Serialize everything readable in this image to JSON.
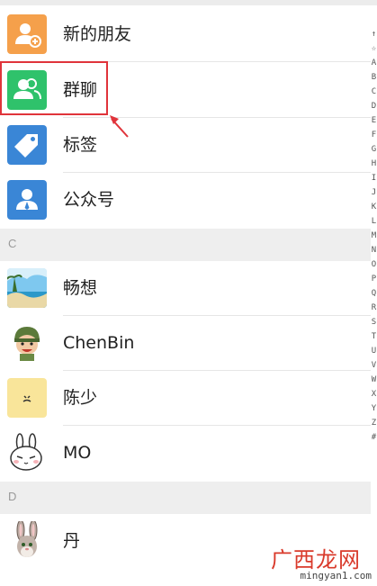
{
  "functions": [
    {
      "label": "新的朋友",
      "icon": "new-friend-icon",
      "color": "#f5a04b"
    },
    {
      "label": "群聊",
      "icon": "group-chat-icon",
      "color": "#2fc26b"
    },
    {
      "label": "标签",
      "icon": "tag-icon",
      "color": "#3a86d6"
    },
    {
      "label": "公众号",
      "icon": "official-account-icon",
      "color": "#3a86d6"
    }
  ],
  "sections": [
    {
      "letter": "C",
      "contacts": [
        "畅想",
        "ChenBin",
        "陈少",
        "MO"
      ]
    },
    {
      "letter": "D",
      "contacts": [
        "丹"
      ]
    }
  ],
  "annotation": {
    "highlight_color": "#e0343b"
  },
  "index_bar": [
    "↑",
    "☆",
    "A",
    "B",
    "C",
    "D",
    "E",
    "F",
    "G",
    "H",
    "I",
    "J",
    "K",
    "L",
    "M",
    "N",
    "O",
    "P",
    "Q",
    "R",
    "S",
    "T",
    "U",
    "V",
    "W",
    "X",
    "Y",
    "Z",
    "#"
  ],
  "watermark": {
    "url": "mingyan1.com",
    "logo": "广西龙网"
  }
}
